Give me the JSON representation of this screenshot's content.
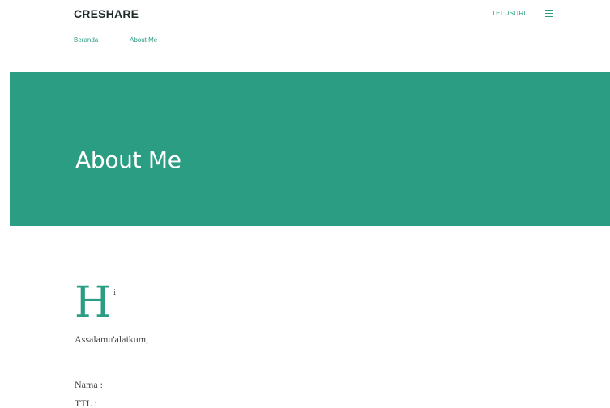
{
  "header": {
    "site_title": "CRESHARE",
    "search_label": "TELUSURI",
    "menu_icon": "hamburger-menu-icon"
  },
  "nav": {
    "items": [
      {
        "label": "Beranda"
      },
      {
        "label": "About Me"
      }
    ]
  },
  "hero": {
    "title": "About Me",
    "background_color": "#2a9d82"
  },
  "content": {
    "dropcap_letter": "H",
    "dropcap_rest": "i",
    "greeting": "Assalamu'alaikum,",
    "lines": [
      "Nama :",
      "TTL :"
    ]
  },
  "colors": {
    "accent": "#2a9d82",
    "title_text": "#1f2a2a"
  }
}
